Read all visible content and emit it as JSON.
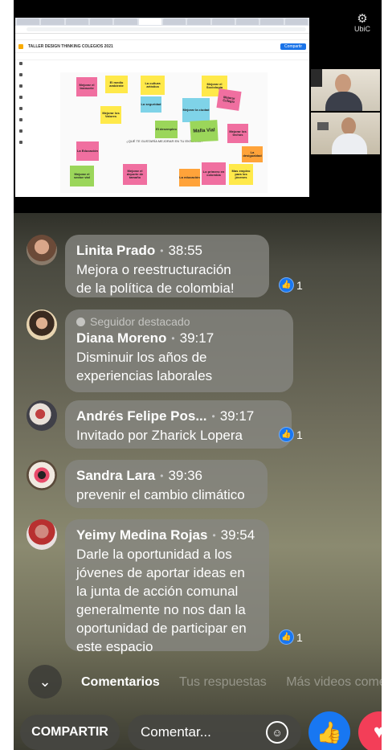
{
  "screen": {
    "board_title": "TALLER DESIGN THINKING COLEGIOS 2021",
    "share_label": "Compartir",
    "center_question": "¿QUÉ TE GUSTARÍA MEJORAR EN TU ENTORNO?",
    "notes": [
      {
        "text": "Mejorar el transorte",
        "color": "#f06fa0"
      },
      {
        "text": "El medio ambiente",
        "color": "#ffe94a"
      },
      {
        "text": "La cultura artística",
        "color": "#ffe94a"
      },
      {
        "text": "Mejorar el Sociología",
        "color": "#ffe94a"
      },
      {
        "text": "Mejorar los Valores",
        "color": "#ffe94a"
      },
      {
        "text": "La seguridad",
        "color": "#7fd3e8"
      },
      {
        "text": "Mejorar la ciudad",
        "color": "#7fd3e8"
      },
      {
        "text": "Mejorar Colegio",
        "color": "#f06fa0"
      },
      {
        "text": "Malla Vial",
        "color": "#9bd65a"
      },
      {
        "text": "El desempleo",
        "color": "#9bd65a"
      },
      {
        "text": "Mejorar los techos",
        "color": "#f06fa0"
      },
      {
        "text": "La Educación",
        "color": "#f06fa0"
      },
      {
        "text": "Mejorar el sector vial",
        "color": "#9bd65a"
      },
      {
        "text": "Mejorar el deporte de tamaño",
        "color": "#f06fa0"
      },
      {
        "text": "La educación",
        "color": "#ffa33a"
      },
      {
        "text": "Lo primero en colombia",
        "color": "#f06fa0"
      },
      {
        "text": "Mas empleo para los jóvenes",
        "color": "#ffe94a"
      },
      {
        "text": "La desigualdad",
        "color": "#ffa33a"
      }
    ]
  },
  "settings_label": "UbiC",
  "comments": [
    {
      "name": "Linita Prado",
      "time": "38:55",
      "message": "Mejora o reestructuración\nde la política de colombia!",
      "likes": "1"
    },
    {
      "follower_tag": "Seguidor destacado",
      "name": "Diana Moreno",
      "time": "39:17",
      "message": "Disminuir los años de\nexperiencias laborales",
      "likes": ""
    },
    {
      "name": "Andrés Felipe Pos...",
      "time": "39:17",
      "message": "Invitado por Zharick Lopera",
      "likes": "1"
    },
    {
      "name": "Sandra Lara",
      "time": "39:36",
      "message": "prevenir el cambio climático",
      "likes": ""
    },
    {
      "name": "Yeimy Medina Rojas",
      "time": "39:54",
      "message": "Darle la oportunidad a los\njóvenes de aportar ideas en\nla junta de acción comunal\ngeneralmente no nos dan la\noportunidad de participar en\neste espacio",
      "likes": "1"
    }
  ],
  "tabs": [
    {
      "label": "Comentarios",
      "active": true
    },
    {
      "label": "Tus respuestas",
      "active": false
    },
    {
      "label": "Más videos come",
      "active": false
    }
  ],
  "bottom_bar": {
    "share_label": "COMPARTIR",
    "comment_placeholder": "Comentar..."
  },
  "colors": {
    "facebook_blue": "#1877f2",
    "love_red": "#f33e58"
  }
}
